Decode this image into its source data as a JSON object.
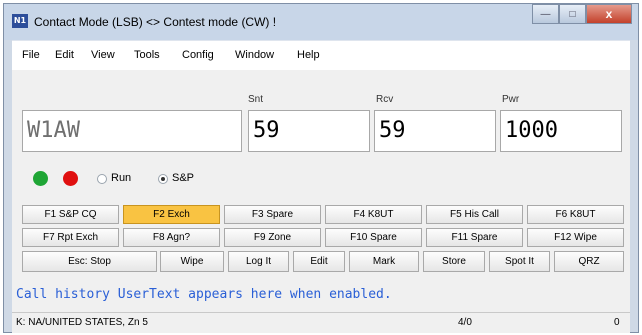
{
  "window": {
    "title": "Contact Mode (LSB) <> Contest mode (CW) !",
    "icon_text": "N1",
    "close_label": "x"
  },
  "menu": [
    "File",
    "Edit",
    "View",
    "Tools",
    "Config",
    "Window",
    "Help"
  ],
  "entry": {
    "call_value": "W1AW",
    "snt_label": "Snt",
    "snt_value": "59",
    "rcv_label": "Rcv",
    "rcv_value": "59",
    "pwr_label": "Pwr",
    "pwr_value": "1000"
  },
  "mode": {
    "run_label": "Run",
    "sp_label": "S&P",
    "selected": "S&P",
    "green_color": "#1fa535",
    "red_color": "#e01010"
  },
  "fkeys_row1": [
    "F1 S&P CQ",
    "F2 Exch",
    "F3 Spare",
    "F4 K8UT",
    "F5 His Call",
    "F6 K8UT"
  ],
  "fkeys_row2": [
    "F7 Rpt Exch",
    "F8 Agn?",
    "F9 Zone",
    "F10 Spare",
    "F11 Spare",
    "F12 Wipe"
  ],
  "fkeys_active": "F2 Exch",
  "actions": [
    "Esc: Stop",
    "Wipe",
    "Log It",
    "Edit",
    "Mark",
    "Store",
    "Spot It",
    "QRZ"
  ],
  "history_text": "Call history UserText appears here when enabled.",
  "status": {
    "country": "K: NA/UNITED STATES, Zn 5",
    "count": "4/0",
    "right": "0"
  }
}
